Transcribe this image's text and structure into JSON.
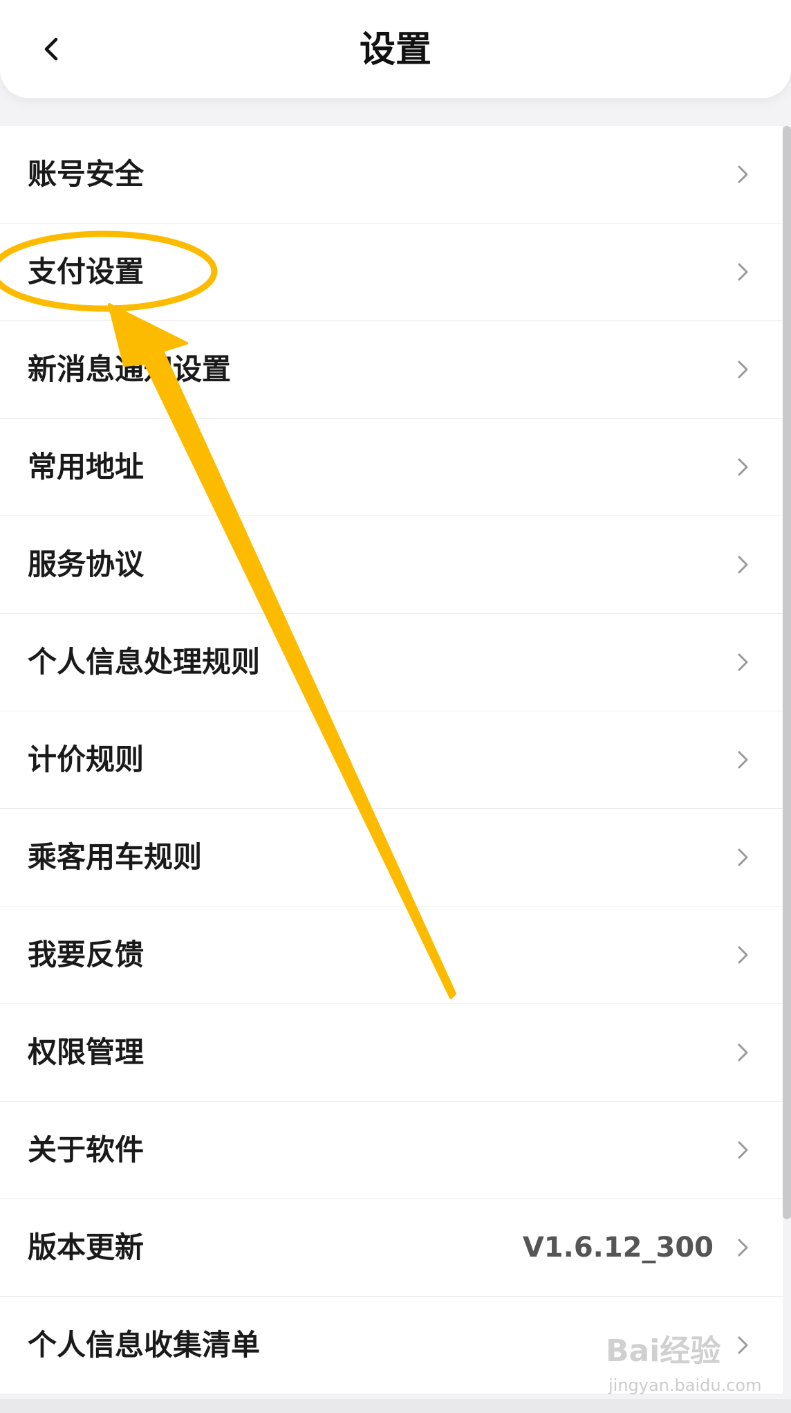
{
  "header": {
    "title": "设置",
    "back_icon": "chevron-left-icon"
  },
  "settings": {
    "items": [
      {
        "label": "账号安全",
        "value": ""
      },
      {
        "label": "支付设置",
        "value": ""
      },
      {
        "label": "新消息通知设置",
        "value": ""
      },
      {
        "label": "常用地址",
        "value": ""
      },
      {
        "label": "服务协议",
        "value": ""
      },
      {
        "label": "个人信息处理规则",
        "value": ""
      },
      {
        "label": "计价规则",
        "value": ""
      },
      {
        "label": "乘客用车规则",
        "value": ""
      },
      {
        "label": "我要反馈",
        "value": ""
      },
      {
        "label": "权限管理",
        "value": ""
      },
      {
        "label": "关于软件",
        "value": ""
      },
      {
        "label": "版本更新",
        "value": "V1.6.12_300"
      },
      {
        "label": "个人信息收集清单",
        "value": ""
      }
    ],
    "chevron_icon": "chevron-right-icon"
  },
  "annotation": {
    "color": "#FDBB00",
    "highlighted_item": "支付设置"
  },
  "watermark": {
    "brand": "Bai经验",
    "url": "jingyan.baidu.com"
  }
}
